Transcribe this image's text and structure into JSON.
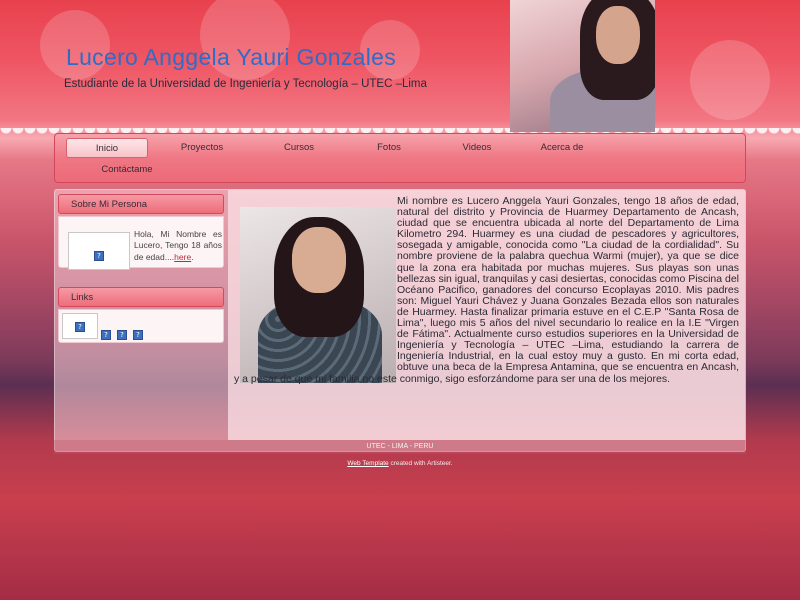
{
  "header": {
    "title": "Lucero Anggela Yauri Gonzales",
    "slogan": "Estudiante de la Universidad de Ingeniería y Tecnología – UTEC –Lima"
  },
  "nav": {
    "items": [
      {
        "label": "Inicio",
        "active": true
      },
      {
        "label": "Proyectos"
      },
      {
        "label": "Cursos"
      },
      {
        "label": "Fotos"
      },
      {
        "label": "Videos"
      },
      {
        "label": "Acerca de"
      },
      {
        "label": "Contáctame"
      }
    ]
  },
  "sidebar": {
    "about": {
      "header": "Sobre Mi Persona",
      "text": "Hola, Mi Nombre es Lucero, Tengo 18 años de edad....",
      "link": "here"
    },
    "links": {
      "header": "Links"
    }
  },
  "main": {
    "paragraph": "Mi nombre es Lucero Anggela Yauri Gonzales, tengo 18 años de edad, natural del distrito y Provincia de Huarmey Departamento de Ancash, ciudad que se encuentra ubicada al norte del Departamento de Lima Kilometro 294. Huarmey es una ciudad de pescadores y agricultores, sosegada y amigable, conocida como \"La ciudad de la cordialidad\". Su nombre proviene de la palabra quechua Warmi (mujer), ya que se dice que la zona era habitada por muchas mujeres. Sus playas son unas bellezas sin igual, tranquilas y casi desiertas, conocidas como Piscina del Océano Pacifico, ganadores del concurso Ecoplayas 2010. Mis padres son: Miguel Yauri Chávez y Juana Gonzales Bezada ellos son naturales de Huarmey. Hasta finalizar primaria estuve en el C.E.P \"Santa Rosa de Lima\", luego mis 5 años del nivel secundario lo realice    en la I.E \"Virgen de Fátima\". Actualmente curso estudios superiores en la Universidad de Ingeniería y Tecnología – UTEC –Lima, estudiando la carrera de Ingeniería Industrial, en la cual estoy muy a gusto. En mi corta edad, obtuve una beca de la Empresa Antamina, que se encuentra en Ancash,  y a pesar de  que mi familia no este conmigo, sigo esforzándome para ser una de los mejores."
  },
  "footer": {
    "text": "UTEC - LIMA - PERU",
    "credit_link": "Web Template",
    "credit_text": " created with Artisteer."
  },
  "icons": {
    "broken_image": "broken-image-icon"
  }
}
